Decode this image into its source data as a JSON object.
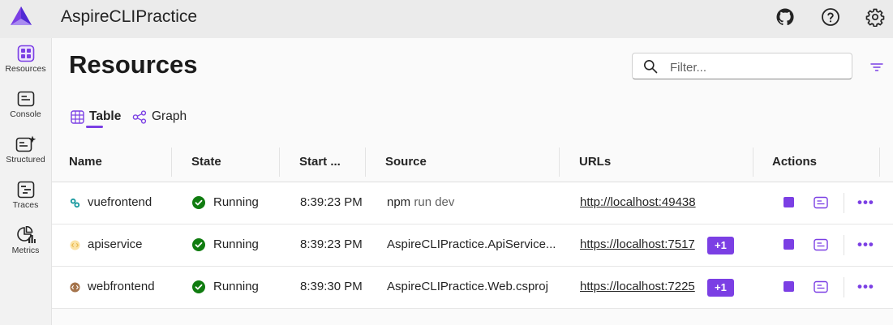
{
  "header": {
    "app_title": "AspireCLIPractice",
    "icons": [
      "github-icon",
      "help-icon",
      "settings-icon"
    ]
  },
  "sidebar": {
    "items": [
      {
        "label": "Resources",
        "icon": "resources-icon",
        "active": true
      },
      {
        "label": "Console",
        "icon": "console-icon"
      },
      {
        "label": "Structured",
        "icon": "structured-icon"
      },
      {
        "label": "Traces",
        "icon": "traces-icon"
      },
      {
        "label": "Metrics",
        "icon": "metrics-icon"
      }
    ]
  },
  "main": {
    "title": "Resources",
    "filter": {
      "placeholder": "Filter...",
      "value": ""
    },
    "tabs": [
      {
        "label": "Table",
        "icon": "table-icon",
        "active": true
      },
      {
        "label": "Graph",
        "icon": "graph-icon"
      }
    ]
  },
  "grid": {
    "columns": [
      "Name",
      "State",
      "Start ...",
      "Source",
      "URLs",
      "Actions"
    ],
    "rows": [
      {
        "name": "vuefrontend",
        "icon": "node-app-icon",
        "state": "Running",
        "start": "8:39:23 PM",
        "source_cmd": "npm",
        "source_args": "run dev",
        "url": "http://localhost:49438",
        "extra": ""
      },
      {
        "name": "apiservice",
        "icon": "project-icon",
        "state": "Running",
        "start": "8:39:23 PM",
        "source_cmd": "AspireCLIPractice.ApiService...",
        "source_args": "",
        "url": "https://localhost:7517",
        "extra": "+1"
      },
      {
        "name": "webfrontend",
        "icon": "web-project-icon",
        "state": "Running",
        "start": "8:39:30 PM",
        "source_cmd": "AspireCLIPractice.Web.csproj",
        "source_args": "",
        "url": "https://localhost:7225",
        "extra": "+1"
      }
    ]
  },
  "colors": {
    "accent": "#7b3fe4",
    "running": "#107c10",
    "header_bg": "#ebebeb"
  }
}
